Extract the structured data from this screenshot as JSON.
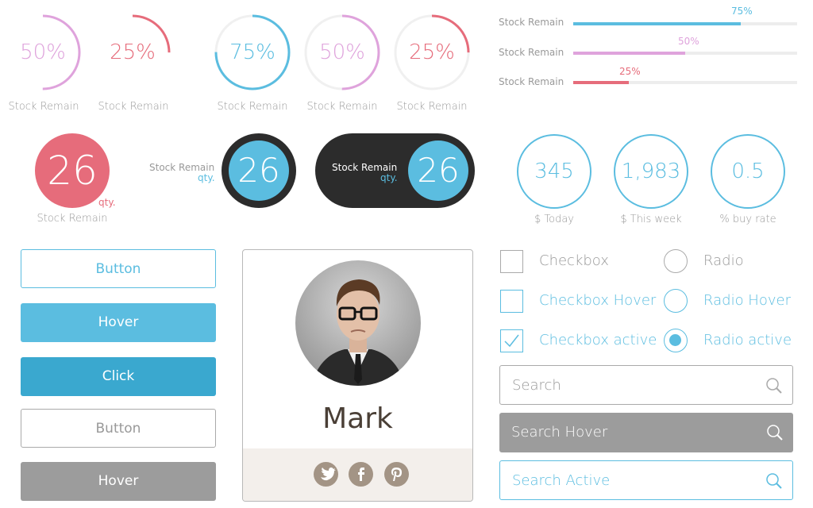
{
  "gauges": [
    {
      "pct_label": "50%",
      "value": 0.5,
      "color": "#dfa3dc",
      "caption": "Stock Remain",
      "track": false
    },
    {
      "pct_label": "25%",
      "value": 0.25,
      "color": "#e66c7b",
      "caption": "Stock Remain",
      "track": false
    },
    {
      "pct_label": "75%",
      "value": 0.75,
      "color": "#5bbde0",
      "caption": "Stock Remain",
      "track": true
    },
    {
      "pct_label": "50%",
      "value": 0.5,
      "color": "#dfa3dc",
      "caption": "Stock Remain",
      "track": true
    },
    {
      "pct_label": "25%",
      "value": 0.25,
      "color": "#e66c7b",
      "caption": "Stock Remain",
      "track": true
    }
  ],
  "linear_bars": [
    {
      "label": "Stock Remain",
      "value": 0.75,
      "value_label": "75%",
      "color": "#5bbde0"
    },
    {
      "label": "Stock Remain",
      "value": 0.5,
      "value_label": "50%",
      "color": "#dfa3dc"
    },
    {
      "label": "Stock Remain",
      "value": 0.25,
      "value_label": "25%",
      "color": "#e66c7b"
    }
  ],
  "qty_widgets": [
    {
      "number": "26",
      "unit": "qty.",
      "label": "Stock Remain",
      "color": "#e66c7b"
    },
    {
      "number": "26",
      "unit": "qty.",
      "label": "Stock Remain",
      "color": "#5bbde0"
    },
    {
      "number": "26",
      "unit": "qty.",
      "label": "Stock Remain",
      "color": "#5bbde0"
    }
  ],
  "stats": [
    {
      "value": "345",
      "label": "$ Today"
    },
    {
      "value": "1,983",
      "label": "$ This week"
    },
    {
      "value": "0.5",
      "label": "% buy rate"
    }
  ],
  "buttons": {
    "normal": "Button",
    "hover": "Hover",
    "click": "Click",
    "normal2": "Button",
    "hover2": "Hover"
  },
  "profile": {
    "name": "Mark"
  },
  "options": {
    "checkbox": "Checkbox",
    "checkbox_hover": "Checkbox Hover",
    "checkbox_active": "Checkbox active",
    "radio": "Radio",
    "radio_hover": "Radio Hover",
    "radio_active": "Radio active"
  },
  "search": {
    "normal": "Search",
    "hover": "Search Hover",
    "active": "Search Active"
  },
  "colors": {
    "accent": "#5bbde0",
    "accent_dark": "#3aa8cf",
    "pink": "#dfa3dc",
    "red": "#e66c7b",
    "gray": "#999999",
    "dark": "#2c2c2c"
  },
  "icons": [
    "search-icon",
    "twitter-icon",
    "facebook-icon",
    "pinterest-icon",
    "check-icon"
  ]
}
